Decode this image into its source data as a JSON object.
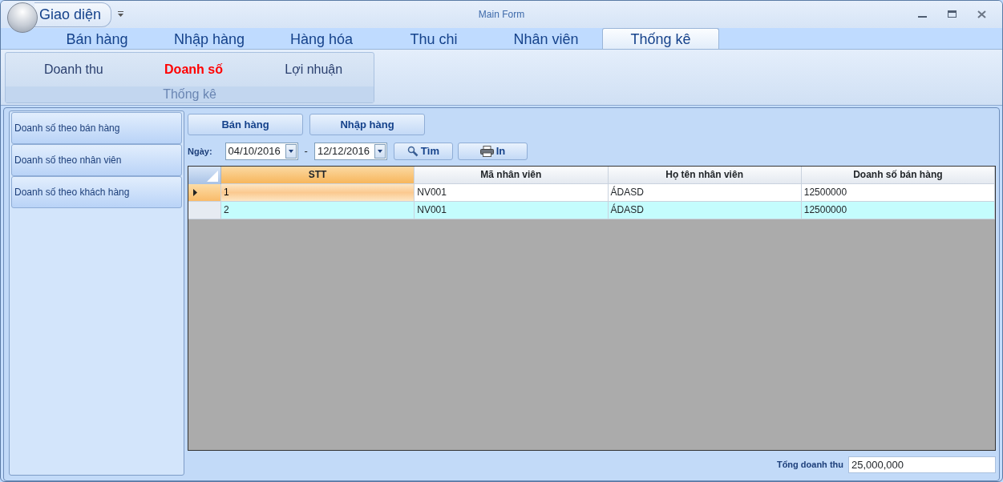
{
  "window": {
    "title": "Main Form"
  },
  "app_menu": {
    "label": "Giao diện"
  },
  "tabs": [
    {
      "label": "Bán hàng",
      "selected": false
    },
    {
      "label": "Nhập hàng",
      "selected": false
    },
    {
      "label": "Hàng hóa",
      "selected": false
    },
    {
      "label": "Thu chi",
      "selected": false
    },
    {
      "label": "Nhân viên",
      "selected": false
    },
    {
      "label": "Thống kê",
      "selected": true
    }
  ],
  "ribbon": {
    "group": "Thống kê",
    "items": [
      {
        "label": "Doanh thu",
        "selected": false
      },
      {
        "label": "Doanh số",
        "selected": true
      },
      {
        "label": "Lợi nhuận",
        "selected": false
      }
    ]
  },
  "sidebar": {
    "items": [
      {
        "label": "Doanh số theo bán hàng"
      },
      {
        "label": "Doanh số theo nhân viên"
      },
      {
        "label": "Doanh số theo khách hàng"
      }
    ]
  },
  "mode_buttons": [
    "Bán hàng",
    "Nhập hàng"
  ],
  "filter": {
    "label": "Ngày:",
    "from": "04/10/2016",
    "separator": "-",
    "to": "12/12/2016",
    "search_button": "Tìm",
    "print_button": "In"
  },
  "table": {
    "columns": [
      "STT",
      "Mã nhân viên",
      "Họ tên nhân viên",
      "Doanh số bán hàng"
    ],
    "rows": [
      {
        "selected": true,
        "cells": [
          "1",
          "NV001",
          "ÁDASD",
          "12500000"
        ]
      },
      {
        "selected": false,
        "cells": [
          "2",
          "NV001",
          "ÁDASD",
          "12500000"
        ]
      }
    ]
  },
  "total": {
    "label": "Tổng doanh thu",
    "value": "25,000,000"
  }
}
